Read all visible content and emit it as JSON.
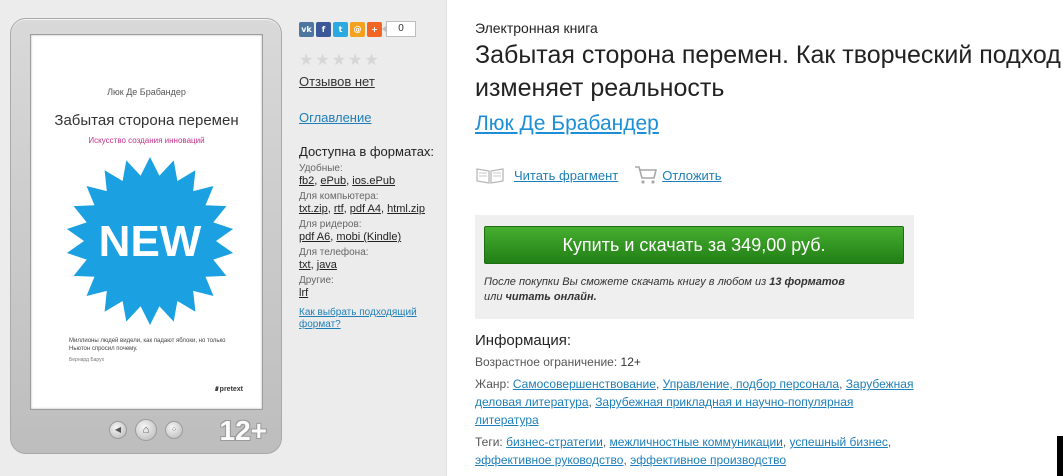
{
  "cover": {
    "author": "Люк Де Брабандер",
    "title": "Забытая сторона перемен",
    "subtitle": "Искусство создания инноваций",
    "badge_text": "NEW",
    "blurb": "Миллионы людей видели, как падают яблоки, но только Ньютон спросил почему.",
    "blurb_author": "Бернард Барух",
    "publisher": "pretext"
  },
  "reader": {
    "age_rating": "12+"
  },
  "social": {
    "share_count": "0",
    "icons": [
      "vk-icon",
      "facebook-icon",
      "twitter-icon",
      "mail-icon",
      "plus-icon"
    ]
  },
  "rating": {
    "stars": "★★★★★",
    "reviews_label": "Отзывов нет"
  },
  "toc_label": "Оглавление",
  "formats": {
    "title": "Доступна в форматах:",
    "groups": [
      {
        "label": "Удобные:",
        "items": [
          "fb2",
          "ePub",
          "ios.ePub"
        ]
      },
      {
        "label": "Для компьютера:",
        "items": [
          "txt.zip",
          "rtf",
          "pdf A4",
          "html.zip"
        ]
      },
      {
        "label": "Для ридеров:",
        "items": [
          "pdf A6",
          "mobi (Kindle)"
        ]
      },
      {
        "label": "Для телефона:",
        "items": [
          "txt",
          "java"
        ]
      },
      {
        "label": "Другие:",
        "items": [
          "lrf"
        ]
      }
    ],
    "choose_link": "Как выбрать подходящий формат?"
  },
  "book": {
    "kind": "Электронная книга",
    "title": "Забытая сторона перемен. Как творческий подход изменяет реальность",
    "author": "Люк Де Брабандер"
  },
  "actions": {
    "read_fragment": "Читать фрагмент",
    "postpone": "Отложить"
  },
  "buy": {
    "button": "Купить и скачать за 349,00 руб.",
    "note_1": "После покупки Вы сможете скачать книгу в любом из ",
    "note_bold_1": "13 форматов",
    "note_2": " или ",
    "note_bold_2": "читать онлайн."
  },
  "info": {
    "title": "Информация:",
    "age_label": "Возрастное ограничение:",
    "age_value": "12+",
    "genre_label": "Жанр:",
    "genres": [
      "Самосовершенствование",
      "Управление, подбор персонала",
      "Зарубежная деловая литература",
      "Зарубежная прикладная и научно-популярная литература"
    ],
    "tags_label": "Теги:",
    "tags": [
      "бизнес-стратегии",
      "межличностные коммуникации",
      "успешный бизнес",
      "эффективное руководство",
      "эффективное производство"
    ]
  },
  "colors": {
    "accent": "#1e8fd6",
    "buy_button": "#2f9a22",
    "badge": "#1ba0e2"
  }
}
